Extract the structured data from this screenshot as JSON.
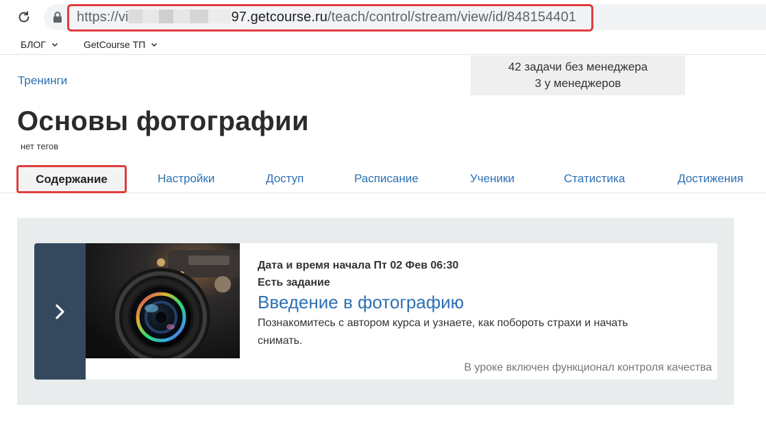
{
  "browser": {
    "url_prefix": "https://vi",
    "url_domain_tail": "97.getcourse.ru",
    "url_path": "/teach/control/stream/view/id/848154401",
    "icons": [
      "reload-icon",
      "lock-icon"
    ]
  },
  "bookmarks": [
    {
      "label": "БЛОГ"
    },
    {
      "label": "GetCourse ТП"
    }
  ],
  "breadcrumb": "Тренинги",
  "tasks": {
    "line1": "42 задачи без менеджера",
    "line2": "3 у менеджеров"
  },
  "page": {
    "title": "Основы фотографии",
    "tags": "нет тегов"
  },
  "tabs": [
    {
      "label": "Содержание",
      "active": true
    },
    {
      "label": "Настройки"
    },
    {
      "label": "Доступ"
    },
    {
      "label": "Расписание"
    },
    {
      "label": "Ученики"
    },
    {
      "label": "Статистика"
    },
    {
      "label": "Достижения"
    }
  ],
  "lesson": {
    "start": "Дата и время начала Пт 02 Фев 06:30",
    "has_task": "Есть задание",
    "title": "Введение в фотографию",
    "description": "Познакомитесь с автором курса и узнаете, как побороть страхи и начать снимать.",
    "quality": "В уроке включен функционал контроля качества"
  },
  "colors": {
    "link": "#2c6fb3",
    "highlight": "#e03b3b",
    "card_side": "#34495e",
    "panel": "#e9eced"
  }
}
